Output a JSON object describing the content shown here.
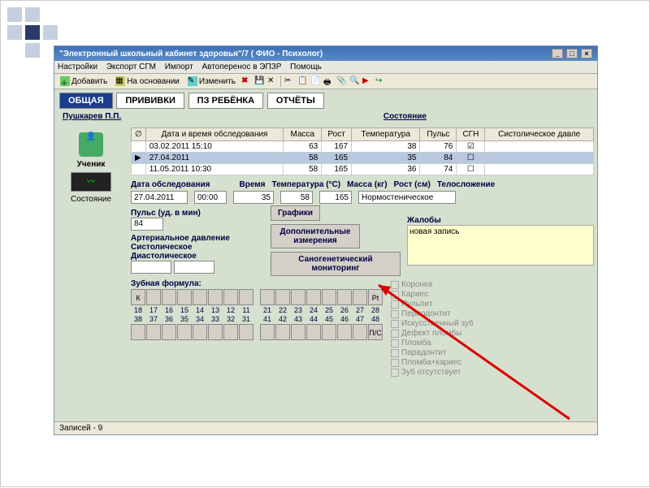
{
  "window": {
    "title": "\"Электронный школьный кабинет здоровья\"/7 ( ФИО - Психолог)"
  },
  "menu": [
    "Настройки",
    "Экспорт СГМ",
    "Импорт",
    "Автоперенос в ЭПЗР",
    "Помощь"
  ],
  "toolbarBtns": {
    "add": "Добавить",
    "based": "На основании",
    "edit": "Изменить"
  },
  "tabs": [
    {
      "label": "ОБЩАЯ",
      "active": true
    },
    {
      "label": "ПРИВИВКИ"
    },
    {
      "label": "ПЗ РЕБЁНКА"
    },
    {
      "label": "ОТЧЁТЫ"
    }
  ],
  "header": {
    "name": "Пушкарев П.П.",
    "link": "Состояние"
  },
  "side": {
    "student": "Ученик",
    "state": "Состояние"
  },
  "gridHeaders": [
    "",
    "Дата и время обследования",
    "Масса",
    "Рост",
    "Температура",
    "Пульс",
    "СГН",
    "Систолическое давле"
  ],
  "gridRows": [
    {
      "dt": "03.02.2011 15:10",
      "mass": "63",
      "h": "167",
      "t": "38",
      "p": "76",
      "sgn": true
    },
    {
      "dt": "27.04.2011",
      "mass": "58",
      "h": "165",
      "t": "35",
      "p": "84",
      "sgn": false,
      "sel": true,
      "mark": "▶"
    },
    {
      "dt": "11.05.2011 10:30",
      "mass": "58",
      "h": "165",
      "t": "36",
      "p": "74",
      "sgn": false
    }
  ],
  "form": {
    "dateLabel": "Дата обследования",
    "date": "27.04.2011",
    "timeLabel": "Время",
    "time": "00:00",
    "tempLabel": "Температура (°C)",
    "temp": "35",
    "massLabel": "Масса (кг)",
    "mass": "58",
    "heightLabel": "Рост (см)",
    "height": "165",
    "bodyLabel": "Телосложение",
    "body": "Нормостеническое",
    "pulseLabel": "Пульс (уд. в мин)",
    "pulse": "84",
    "bpLabel": "Артериальное давление",
    "sysLabel": "Систолическое",
    "diaLabel": "Диастолическое",
    "complaintsLabel": "Жалобы",
    "complaints": "новая запись",
    "chartsBtn": "Графики",
    "extraBtn": "Дополнительные измерения",
    "sanoBtn": "Саногенетический мониторинг"
  },
  "dental": {
    "label": "Зубная формула:",
    "top1": [
      "18",
      "17",
      "16",
      "15",
      "14",
      "13",
      "12",
      "11"
    ],
    "top2": [
      "21",
      "22",
      "23",
      "24",
      "25",
      "26",
      "27",
      "28"
    ],
    "bot1": [
      "38",
      "37",
      "36",
      "35",
      "34",
      "33",
      "32",
      "31"
    ],
    "bot2": [
      "41",
      "42",
      "43",
      "44",
      "45",
      "46",
      "47",
      "48"
    ],
    "k": "К",
    "pt": "Pt",
    "ps": "П/С"
  },
  "checks": [
    "Коронка",
    "Кариес",
    "Пульпит",
    "Периодонтит",
    "Искусственный зуб",
    "Дефект пломбы",
    "Пломба",
    "Парадонтит",
    "Пломба+кариес",
    "Зуб отсутствует"
  ],
  "status": "Записей - 9"
}
